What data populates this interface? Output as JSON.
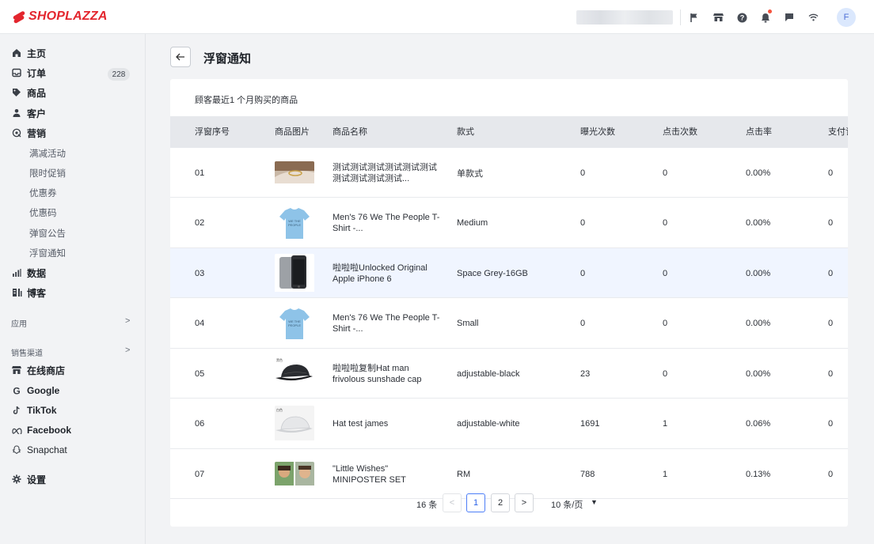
{
  "header": {
    "logo_text": "SHOPLAZZA",
    "avatar_initial": "F",
    "icons": [
      "flag-icon",
      "store-icon",
      "help-icon",
      "bell-icon",
      "chat-icon",
      "wifi-icon"
    ],
    "brand_color": "#e3262e"
  },
  "sidebar": {
    "items": [
      {
        "label": "主页",
        "icon": "home-icon"
      },
      {
        "label": "订单",
        "icon": "inbox-icon",
        "badge": "228"
      },
      {
        "label": "商品",
        "icon": "tag-icon"
      },
      {
        "label": "客户",
        "icon": "person-icon"
      },
      {
        "label": "营销",
        "icon": "megaphone-icon"
      }
    ],
    "marketing_subitems": [
      "满减活动",
      "限时促销",
      "优惠券",
      "优惠码",
      "弹窗公告",
      "浮窗通知"
    ],
    "items2": [
      {
        "label": "数据",
        "icon": "chart-icon"
      },
      {
        "label": "博客",
        "icon": "blog-icon"
      }
    ],
    "apps_label": "应用",
    "channels_label": "销售渠道",
    "channels": [
      {
        "label": "在线商店",
        "icon": "store-icon"
      },
      {
        "label": "Google",
        "icon": "google-icon"
      },
      {
        "label": "TikTok",
        "icon": "tiktok-icon"
      },
      {
        "label": "Facebook",
        "icon": "meta-icon"
      },
      {
        "label": "Snapchat",
        "icon": "snapchat-icon"
      }
    ],
    "settings_label": "设置"
  },
  "main": {
    "title": "浮窗通知",
    "subtitle": "顾客最近1 个月购买的商品",
    "columns": [
      "浮窗序号",
      "商品图片",
      "商品名称",
      "款式",
      "曝光次数",
      "点击次数",
      "点击率",
      "支付订"
    ],
    "rows": [
      {
        "index": "01",
        "name": "测试测试测试测试测试测试测试测试测试测试...",
        "variant": "单款式",
        "impressions": "0",
        "clicks": "0",
        "ctr": "0.00%",
        "paid": "0",
        "image": "ring-photo"
      },
      {
        "index": "02",
        "name": "Men's 76 We The People T-Shirt -...",
        "variant": "Medium",
        "impressions": "0",
        "clicks": "0",
        "ctr": "0.00%",
        "paid": "0",
        "image": "tshirt"
      },
      {
        "index": "03",
        "name": "啦啦啦Unlocked Original Apple iPhone 6",
        "variant": "Space Grey-16GB",
        "impressions": "0",
        "clicks": "0",
        "ctr": "0.00%",
        "paid": "0",
        "image": "iphone"
      },
      {
        "index": "04",
        "name": "Men's 76 We The People T-Shirt -...",
        "variant": "Small",
        "impressions": "0",
        "clicks": "0",
        "ctr": "0.00%",
        "paid": "0",
        "image": "tshirt"
      },
      {
        "index": "05",
        "name": "啦啦啦复制Hat man frivolous sunshade cap",
        "variant": "adjustable-black",
        "impressions": "23",
        "clicks": "0",
        "ctr": "0.00%",
        "paid": "0",
        "image": "black-cap"
      },
      {
        "index": "06",
        "name": "Hat test james",
        "variant": "adjustable-white",
        "impressions": "1691",
        "clicks": "1",
        "ctr": "0.06%",
        "paid": "0",
        "image": "white-cap"
      },
      {
        "index": "07",
        "name": "\"Little Wishes\" MINIPOSTER SET",
        "variant": "RM",
        "impressions": "788",
        "clicks": "1",
        "ctr": "0.13%",
        "paid": "0",
        "image": "poster"
      }
    ],
    "highlighted_row": 2
  },
  "pagination": {
    "total": "16 条",
    "pages": [
      "1",
      "2"
    ],
    "current": "1",
    "page_size": "10 条/页"
  }
}
